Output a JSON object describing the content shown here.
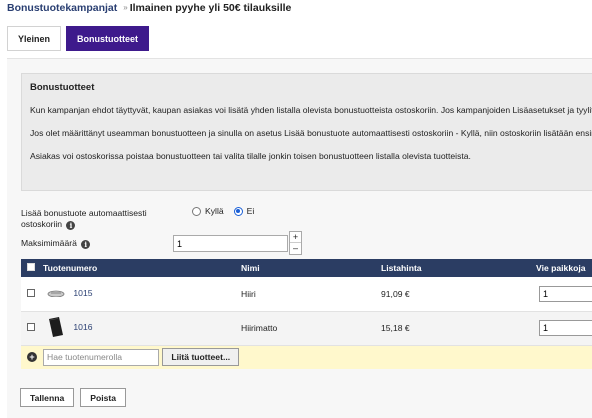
{
  "breadcrumb": {
    "root": "Bonustuotekampanjat",
    "separator": "»",
    "current": "Ilmainen pyyhe yli 50€ tilauksille"
  },
  "tabs": [
    {
      "label": "Yleinen",
      "active": false
    },
    {
      "label": "Bonustuotteet",
      "active": true
    }
  ],
  "info": {
    "title": "Bonustuotteet",
    "paragraphs": [
      "Kun kampanjan ehdot täyttyvät, kaupan asiakas voi lisätä yhden listalla olevista bonustuotteista ostoskoriin. Jos kampanjoiden Lisäasetukset ja tyylit",
      "Jos olet määrittänyt useamman bonustuotteen ja sinulla on asetus Lisää bonustuote automaattisesti ostoskoriin - Kyllä, niin ostoskoriin lisätään ensim",
      "Asiakas voi ostoskorissa poistaa bonustuotteen tai valita tilalle jonkin toisen bonustuotteen listalla olevista tuotteista."
    ]
  },
  "form": {
    "auto_add_label": "Lisää bonustuote automaattisesti ostoskoriin",
    "auto_add_yes": "Kyllä",
    "auto_add_no": "Ei",
    "auto_add_selected": "Ei",
    "max_label": "Maksimimäärä",
    "max_value": "1",
    "info_icon_glyph": "i",
    "stepper_up": "+",
    "stepper_down": "–"
  },
  "table": {
    "columns": [
      "Tuotenumero",
      "Nimi",
      "Listahinta",
      "Vie paikkoja"
    ],
    "rows": [
      {
        "product_number": "1015",
        "name": "Hiiri",
        "price": "91,09 €",
        "slots": "1",
        "icon": "mouse-thumbnail"
      },
      {
        "product_number": "1016",
        "name": "Hiirimatto",
        "price": "15,18 €",
        "slots": "1",
        "icon": "mousepad-thumbnail"
      }
    ],
    "add_row": {
      "search_placeholder": "Hae tuotenumerolla",
      "attach_label": "Liitä tuotteet...",
      "add_icon_glyph": "+"
    }
  },
  "actions": {
    "save_label": "Tallenna",
    "delete_label": "Poista"
  },
  "colors": {
    "accent_tab": "#3e1a8c",
    "table_header": "#2b3d63",
    "link": "#2a3f72",
    "add_row_bg": "#fff8cc"
  }
}
